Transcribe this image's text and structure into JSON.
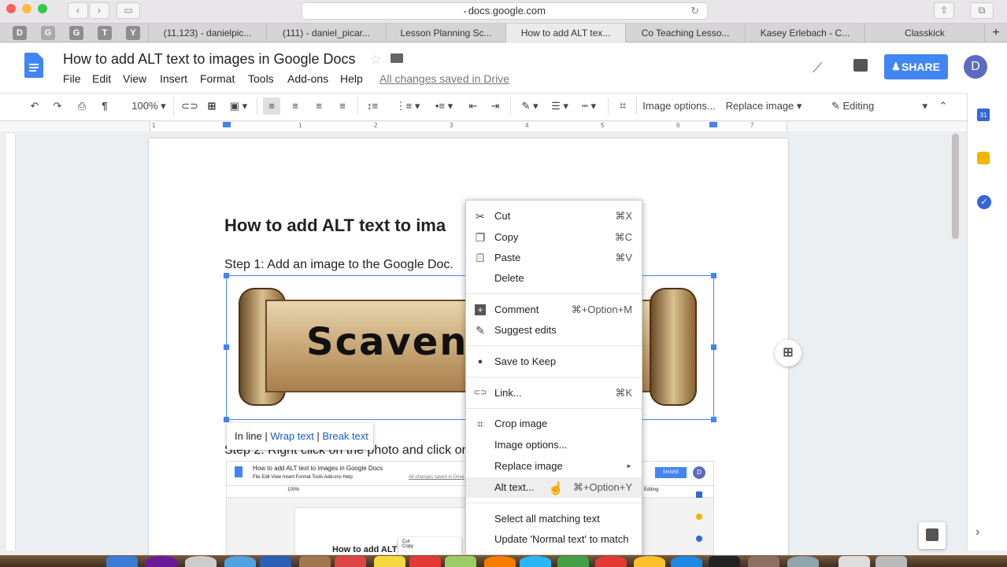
{
  "browser": {
    "url": "docs.google.com",
    "favicon_tabs": [
      "D",
      "G",
      "G",
      "T",
      "Y"
    ],
    "tabs": [
      {
        "label": "(11,123) - danielpic..."
      },
      {
        "label": "(111) - daniel_picar..."
      },
      {
        "label": "Lesson Planning Sc..."
      },
      {
        "label": "How to add ALT tex..."
      },
      {
        "label": "Co Teaching Lesso..."
      },
      {
        "label": "Kasey Erlebach - C..."
      },
      {
        "label": "Classkick"
      }
    ],
    "new_tab": "+"
  },
  "doc": {
    "title": "How to add ALT text to images in Google Docs",
    "menus": [
      "File",
      "Edit",
      "View",
      "Insert",
      "Format",
      "Tools",
      "Add-ons",
      "Help"
    ],
    "saved_status": "All changes saved in Drive",
    "share_label": "SHARE",
    "avatar_letter": "D"
  },
  "toolbar": {
    "zoom": "100%",
    "image_options": "Image options...",
    "replace_image": "Replace image",
    "editing": "Editing"
  },
  "ruler": {
    "labels": [
      "1",
      "1",
      "2",
      "3",
      "4",
      "5",
      "6",
      "7"
    ]
  },
  "content": {
    "heading": "How to add ALT text to ima",
    "step1": "Step 1: Add an image to the Google Doc.",
    "step2": "Step 2: Right click on the photo and click on",
    "image_text": "Scaveng",
    "inline_bar": {
      "inline": "In line",
      "wrap": "Wrap text",
      "break": "Break text",
      "divider": "|"
    }
  },
  "mini_screenshot": {
    "title": "How to add ALT text to images in Google Docs",
    "menus": "File  Edit  View  Insert  Format  Tools  Add-ons  Help",
    "saved": "All changes saved in Drive",
    "share": "SHARE",
    "avatar": "D",
    "zoom": "100%",
    "editing": "Editing",
    "heading": "How to add ALT",
    "cut": "Cut",
    "copy": "Copy"
  },
  "context_menu": {
    "items": [
      {
        "label": "Cut",
        "shortcut": "⌘X",
        "icon": "✂"
      },
      {
        "label": "Copy",
        "shortcut": "⌘C",
        "icon": "❐"
      },
      {
        "label": "Paste",
        "shortcut": "⌘V",
        "icon": "📋"
      },
      {
        "label": "Delete",
        "shortcut": "",
        "icon": ""
      },
      {
        "label": "Comment",
        "shortcut": "⌘+Option+M",
        "icon": "+"
      },
      {
        "label": "Suggest edits",
        "shortcut": "",
        "icon": "✎"
      },
      {
        "label": "Save to Keep",
        "shortcut": "",
        "icon": "●"
      },
      {
        "label": "Link...",
        "shortcut": "⌘K",
        "icon": "⊂⊃"
      },
      {
        "label": "Crop image",
        "shortcut": "",
        "icon": "⌗"
      },
      {
        "label": "Image options...",
        "shortcut": "",
        "icon": ""
      },
      {
        "label": "Replace image",
        "shortcut": "►",
        "icon": ""
      },
      {
        "label": "Alt text...",
        "shortcut": "⌘+Option+Y",
        "icon": ""
      },
      {
        "label": "Select all matching text",
        "shortcut": "",
        "icon": ""
      },
      {
        "label": "Update 'Normal text' to match",
        "shortcut": "",
        "icon": ""
      }
    ]
  },
  "side_panel": {
    "calendar_day": "31"
  },
  "colors": {
    "accent": "#4285f4",
    "avatar": "#5c6bc0",
    "keep_yellow": "#f4b400"
  }
}
